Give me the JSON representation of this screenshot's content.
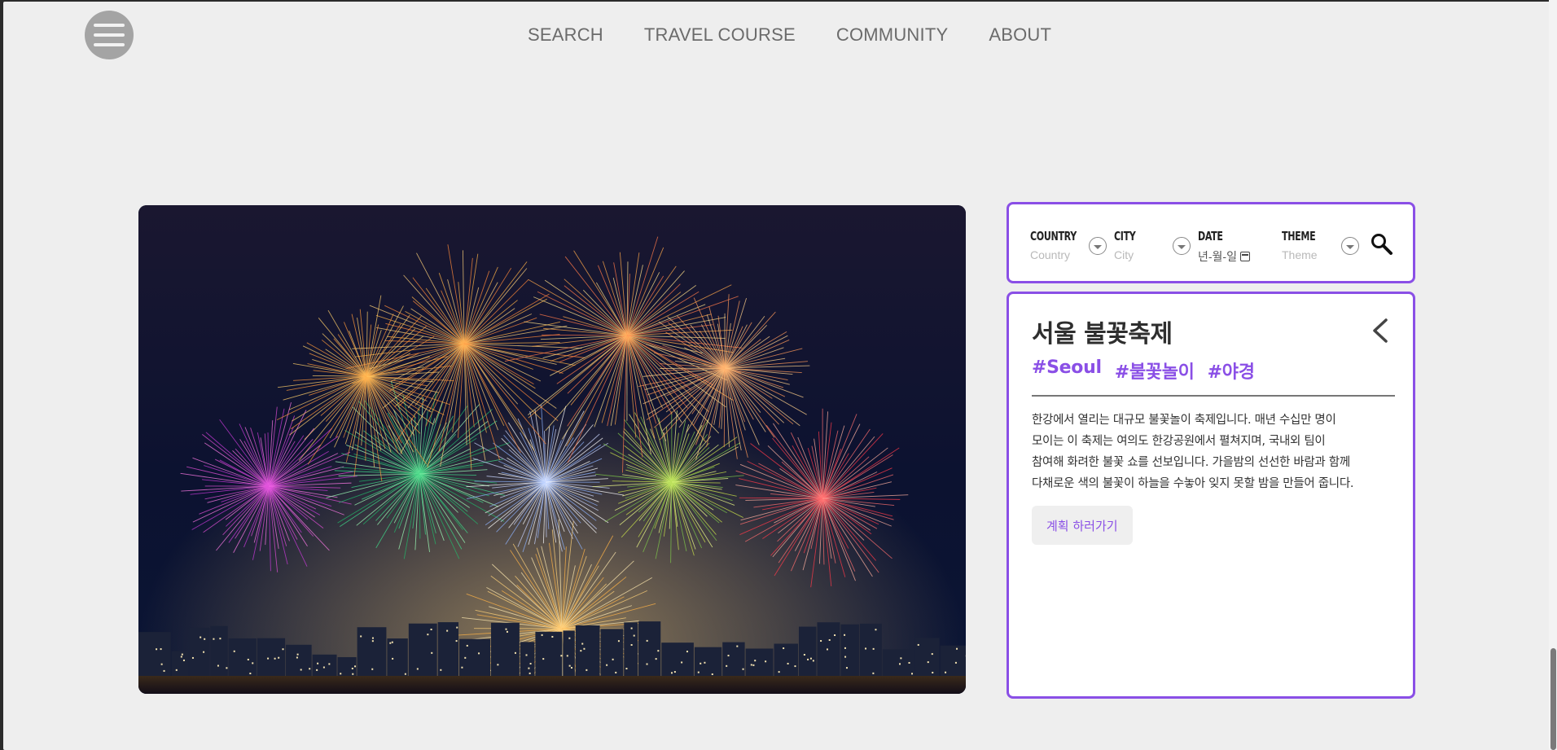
{
  "header": {
    "menu_icon": "hamburger-icon",
    "nav": [
      {
        "label": "SEARCH"
      },
      {
        "label": "TRAVEL COURSE"
      },
      {
        "label": "COMMUNITY"
      },
      {
        "label": "ABOUT"
      }
    ]
  },
  "hero": {
    "image": "fireworks-over-han-river-night"
  },
  "search": {
    "country": {
      "label": "COUNTRY",
      "placeholder": "Country"
    },
    "city": {
      "label": "CITY",
      "placeholder": "City"
    },
    "date": {
      "label": "DATE",
      "placeholder": "년-월-일"
    },
    "theme": {
      "label": "THEME",
      "placeholder": "Theme"
    },
    "search_icon": "search-icon"
  },
  "detail": {
    "title": "서울 불꽃축제",
    "tags": [
      "#Seoul",
      "#불꽃놀이",
      "#야경"
    ],
    "description_lines": [
      "한강에서 열리는 대규모 불꽃놀이 축제입니다. 매년 수십만 명이",
      "모이는 이 축제는 여의도 한강공원에서 펼쳐지며, 국내외 팀이",
      "참여해 화려한 불꽃 쇼를 선보입니다. 가을밤의 선선한 바람과 함께",
      "다채로운 색의 불꽃이 하늘을 수놓아 잊지 못할 밤을 만들어 줍니다."
    ],
    "plan_button": "계획 하러가기",
    "back_icon": "chevron-left-icon"
  },
  "colors": {
    "accent": "#8a4fe6",
    "background": "#eeeeee",
    "nav_text": "#6b6b6b"
  }
}
